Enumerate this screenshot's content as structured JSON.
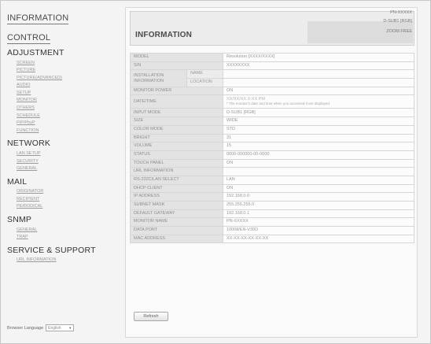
{
  "sidebar": {
    "top_links": [
      {
        "label": "INFORMATION"
      },
      {
        "label": "CONTROL"
      }
    ],
    "sections": [
      {
        "title": "ADJUSTMENT",
        "items": [
          "SCREEN",
          "PICTURE",
          "PICTURE(ADVANCED)",
          "AUDIO",
          "SETUP",
          "MONITOR",
          "OTHERS",
          "SCHEDULE",
          "PIP/PbyP",
          "FUNCTION"
        ]
      },
      {
        "title": "NETWORK",
        "items": [
          "LAN SETUP",
          "SECURITY",
          "GENERAL"
        ]
      },
      {
        "title": "MAIL",
        "items": [
          "ORIGINATOR",
          "RECIPIENT",
          "PERIODICAL"
        ]
      },
      {
        "title": "SNMP",
        "items": [
          "GENERAL",
          "TRAP"
        ]
      },
      {
        "title": "SERVICE & SUPPORT",
        "items": [
          "URL INFORMATION"
        ]
      }
    ],
    "language": {
      "label": "Browser Language",
      "selected": "English"
    }
  },
  "header": {
    "title": "INFORMATION",
    "model_id": "PN-XXXXX",
    "input": "D-SUB1 [RGB]",
    "zoom": "ZOOM FREE"
  },
  "table": {
    "rows": [
      {
        "label": "MODEL",
        "value": "Resolution [XXXX/XXXX]"
      },
      {
        "label": "S/N",
        "value": "XXXXXXXX"
      },
      {
        "label": "INFORMATION",
        "value": "",
        "sub": "NAME"
      },
      {
        "label": "",
        "value": "",
        "sub": "LOCATION"
      },
      {
        "label": "MONITOR POWER",
        "value": "ON"
      },
      {
        "label": "DATE/TIME",
        "value": "XX/XX/XX X:XX PM",
        "note": "* The monitor's date and time when you accessed it are displayed."
      },
      {
        "label": "INPUT MODE",
        "value": "D-SUB1 [RGB]"
      },
      {
        "label": "SIZE",
        "value": "WIDE"
      },
      {
        "label": "COLOR MODE",
        "value": "STD"
      },
      {
        "label": "BRIGHT",
        "value": "31"
      },
      {
        "label": "VOLUME",
        "value": "15"
      },
      {
        "label": "STATUS",
        "value": "0000-000000-00-0000"
      },
      {
        "label": "TOUCH PANEL",
        "value": "ON"
      },
      {
        "label": "URL INFORMATION",
        "value": ""
      },
      {
        "label": "RS-232C/LAN SELECT",
        "value": "LAN"
      },
      {
        "label": "DHCP CLIENT",
        "value": "ON"
      },
      {
        "label": "IP ADDRESS",
        "value": "192.168.0.0"
      },
      {
        "label": "SUBNET MASK",
        "value": "255.255.255.0"
      },
      {
        "label": "DEFAULT GATEWAY",
        "value": "192.168.0.1"
      },
      {
        "label": "MONITOR NAME",
        "value": "PN-XXXXX"
      },
      {
        "label": "DATA PORT",
        "value": "10008/EN-V30D"
      },
      {
        "label": "MAC ADDRESS",
        "value": "XX-XX-XX-XX-XX-XX"
      }
    ]
  },
  "buttons": {
    "refresh": "Refresh"
  }
}
